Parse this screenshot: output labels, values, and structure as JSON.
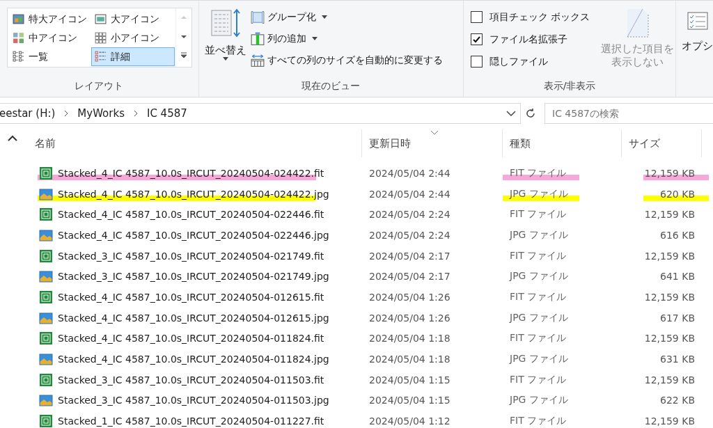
{
  "ribbon": {
    "layout": {
      "label": "レイアウト",
      "items": [
        {
          "label": "特大アイコン",
          "kind": "xl",
          "selected": false
        },
        {
          "label": "大アイコン",
          "kind": "large",
          "selected": false
        },
        {
          "label": "中アイコン",
          "kind": "medium",
          "selected": false
        },
        {
          "label": "小アイコン",
          "kind": "small",
          "selected": false
        },
        {
          "label": "一覧",
          "kind": "list",
          "selected": false
        },
        {
          "label": "詳細",
          "kind": "details",
          "selected": true
        }
      ]
    },
    "current_view": {
      "label": "現在のビュー",
      "sort_button": "並べ替え",
      "buttons": [
        {
          "label": "グループ化",
          "kind": "group",
          "dropdown": true
        },
        {
          "label": "列の追加",
          "kind": "columns",
          "dropdown": true
        },
        {
          "label": "すべての列のサイズを自動的に変更する",
          "kind": "fit",
          "dropdown": false
        }
      ]
    },
    "show_hide": {
      "label": "表示/非表示",
      "checkboxes": [
        {
          "label": "項目チェック ボックス",
          "checked": false
        },
        {
          "label": "ファイル名拡張子",
          "checked": true
        },
        {
          "label": "隠しファイル",
          "checked": false
        }
      ],
      "hide_selected": {
        "lines": [
          "選択した項目を",
          "表示しない"
        ],
        "disabled": true
      }
    },
    "options": {
      "label": "オプシ"
    }
  },
  "address_bar": {
    "path": [
      "eestar (H:)",
      "MyWorks",
      "IC 4587"
    ],
    "search_placeholder": "IC 4587の検索"
  },
  "table": {
    "columns": [
      "名前",
      "更新日時",
      "種類",
      "サイズ"
    ],
    "rows": [
      {
        "kind": "fit",
        "name": "Stacked_4_IC 4587_10.0s_IRCUT_20240504-024422.fit",
        "date": "2024/05/04 2:44",
        "type": "FIT ファイル",
        "size": "12,159 KB",
        "color": "#f7a8d8"
      },
      {
        "kind": "jpg",
        "name": "Stacked_4_IC 4587_10.0s_IRCUT_20240504-024422.jpg",
        "date": "2024/05/04 2:44",
        "type": "JPG ファイル",
        "size": "620 KB",
        "color": "#ffff00"
      },
      {
        "kind": "fit",
        "name": "Stacked_4_IC 4587_10.0s_IRCUT_20240504-022446.fit",
        "date": "2024/05/04 2:24",
        "type": "FIT ファイル",
        "size": "12,159 KB"
      },
      {
        "kind": "jpg",
        "name": "Stacked_4_IC 4587_10.0s_IRCUT_20240504-022446.jpg",
        "date": "2024/05/04 2:24",
        "type": "JPG ファイル",
        "size": "616 KB"
      },
      {
        "kind": "fit",
        "name": "Stacked_3_IC 4587_10.0s_IRCUT_20240504-021749.fit",
        "date": "2024/05/04 2:17",
        "type": "FIT ファイル",
        "size": "12,159 KB"
      },
      {
        "kind": "jpg",
        "name": "Stacked_3_IC 4587_10.0s_IRCUT_20240504-021749.jpg",
        "date": "2024/05/04 2:17",
        "type": "JPG ファイル",
        "size": "641 KB"
      },
      {
        "kind": "fit",
        "name": "Stacked_4_IC 4587_10.0s_IRCUT_20240504-012615.fit",
        "date": "2024/05/04 1:26",
        "type": "FIT ファイル",
        "size": "12,159 KB"
      },
      {
        "kind": "jpg",
        "name": "Stacked_4_IC 4587_10.0s_IRCUT_20240504-012615.jpg",
        "date": "2024/05/04 1:26",
        "type": "JPG ファイル",
        "size": "617 KB"
      },
      {
        "kind": "fit",
        "name": "Stacked_4_IC 4587_10.0s_IRCUT_20240504-011824.fit",
        "date": "2024/05/04 1:18",
        "type": "FIT ファイル",
        "size": "12,159 KB"
      },
      {
        "kind": "jpg",
        "name": "Stacked_4_IC 4587_10.0s_IRCUT_20240504-011824.jpg",
        "date": "2024/05/04 1:18",
        "type": "JPG ファイル",
        "size": "631 KB"
      },
      {
        "kind": "fit",
        "name": "Stacked_3_IC 4587_10.0s_IRCUT_20240504-011503.fit",
        "date": "2024/05/04 1:15",
        "type": "FIT ファイル",
        "size": "12,159 KB"
      },
      {
        "kind": "jpg",
        "name": "Stacked_3_IC 4587_10.0s_IRCUT_20240504-011503.jpg",
        "date": "2024/05/04 1:15",
        "type": "JPG ファイル",
        "size": "622 KB"
      },
      {
        "kind": "fit",
        "name": "Stacked_1_IC 4587_10.0s_IRCUT_20240504-011227.fit",
        "date": "2024/05/04 1:12",
        "type": "FIT ファイル",
        "size": "12,159 KB"
      }
    ]
  }
}
